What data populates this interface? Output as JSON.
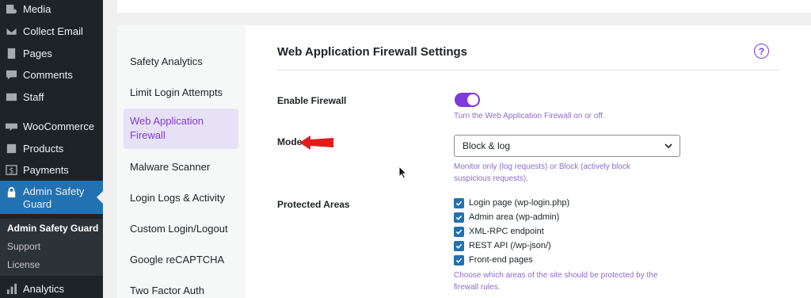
{
  "wp_menu": {
    "items": [
      {
        "label": "Media",
        "icon": "media-icon"
      },
      {
        "label": "Collect Email",
        "icon": "email-icon"
      },
      {
        "label": "Pages",
        "icon": "pages-icon"
      },
      {
        "label": "Comments",
        "icon": "comments-icon"
      },
      {
        "label": "Staff",
        "icon": "staff-icon"
      },
      {
        "label": "WooCommerce",
        "icon": "woocommerce-icon"
      },
      {
        "label": "Products",
        "icon": "products-icon"
      },
      {
        "label": "Payments",
        "icon": "payments-icon"
      },
      {
        "label": "Admin Safety Guard",
        "icon": "lock-icon"
      },
      {
        "label": "Analytics",
        "icon": "analytics-icon"
      }
    ],
    "submenu": [
      "Admin Safety Guard",
      "Support",
      "License"
    ]
  },
  "plugin_nav": {
    "items": [
      "Safety Analytics",
      "Limit Login Attempts",
      "Web Application Firewall",
      "Malware Scanner",
      "Login Logs & Activity",
      "Custom Login/Logout",
      "Google reCAPTCHA",
      "Two Factor Auth"
    ]
  },
  "settings": {
    "title": "Web Application Firewall Settings",
    "help": "?",
    "enable_firewall": {
      "label": "Enable Firewall",
      "enabled": true,
      "description": "Turn the Web Application Firewall on or off."
    },
    "mode": {
      "label": "Mode",
      "value": "Block & log",
      "description_line1": "Monitor only (log requests) or Block (actively block",
      "description_line2": "suspicious requests)."
    },
    "protected_areas": {
      "label": "Protected Areas",
      "options": [
        {
          "label": "Login page (wp-login.php)",
          "checked": true
        },
        {
          "label": "Admin area (wp-admin)",
          "checked": true
        },
        {
          "label": "XML-RPC endpoint",
          "checked": true
        },
        {
          "label": "REST API (/wp-json/)",
          "checked": true
        },
        {
          "label": "Front-end pages",
          "checked": true
        }
      ],
      "description_line1": "Choose which areas of the site should be protected by the",
      "description_line2": "firewall rules."
    }
  },
  "colors": {
    "accent": "#7d3bde",
    "wp_sidebar": "#1d2327",
    "wp_active": "#2271b1",
    "annotation_arrow": "#e8191b"
  }
}
